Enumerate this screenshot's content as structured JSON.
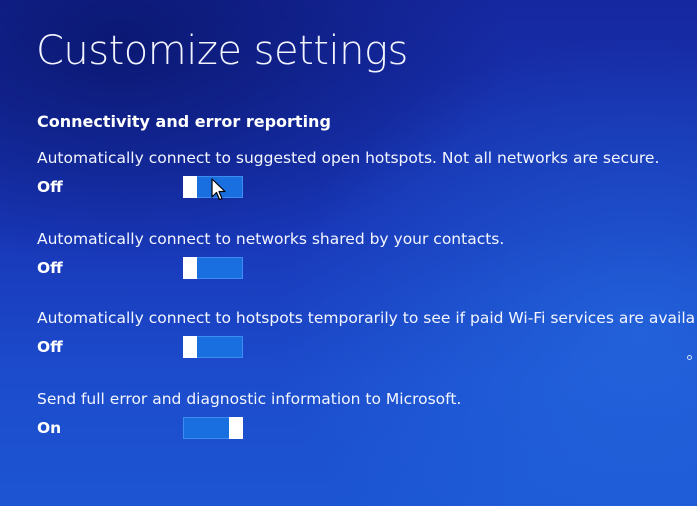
{
  "page": {
    "title": "Customize settings"
  },
  "section": {
    "title": "Connectivity and error reporting"
  },
  "settings": [
    {
      "label": "Automatically connect to suggested open hotspots. Not all networks are secure.",
      "state": "Off",
      "on": false
    },
    {
      "label": "Automatically connect to networks shared by your contacts.",
      "state": "Off",
      "on": false
    },
    {
      "label": "Automatically connect to hotspots temporarily to see if paid Wi-Fi services are availa",
      "state": "Off",
      "on": false
    },
    {
      "label": "Send full error and diagnostic information to Microsoft.",
      "state": "On",
      "on": true
    }
  ],
  "colors": {
    "background": "#1837b8",
    "toggle_track": "#1a6fe0",
    "toggle_thumb": "#ffffff",
    "text": "#ffffff"
  },
  "icons": {
    "cursor": "mouse-pointer-icon"
  }
}
